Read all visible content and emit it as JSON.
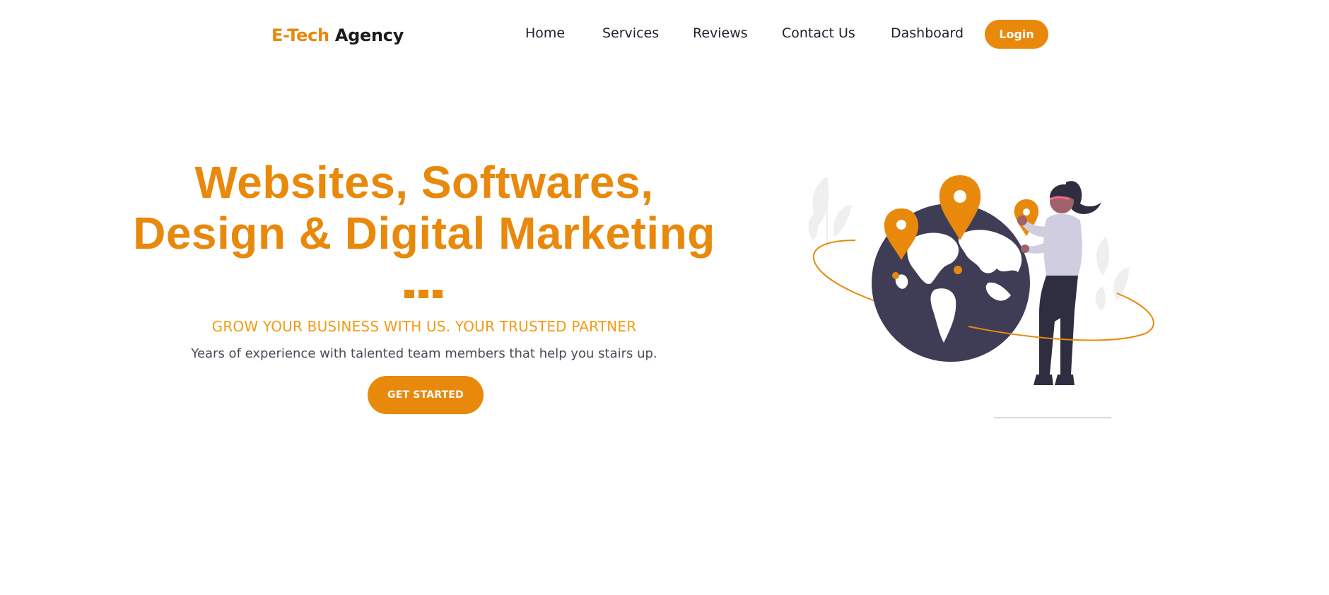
{
  "brand": {
    "accent": "E-Tech",
    "name": "Agency"
  },
  "nav": {
    "items": [
      "Home",
      "Services",
      "Reviews",
      "Contact Us",
      "Dashboard"
    ],
    "login_label": "Login"
  },
  "hero": {
    "title_line1": "Websites, Softwares,",
    "title_line2": "Design & Digital Marketing",
    "subtitle": "GROW YOUR BUSINESS WITH US. YOUR TRUSTED PARTNER",
    "description": "Years of experience with talented team members that help you stairs up.",
    "cta_label": "GET STARTED"
  },
  "colors": {
    "accent": "#e8890c",
    "subtitle": "#f29b13",
    "dark": "#3f3d56",
    "text": "#4a4a57"
  },
  "icons": {
    "illustration": "woman-with-globe-and-location-pins-illustration"
  }
}
